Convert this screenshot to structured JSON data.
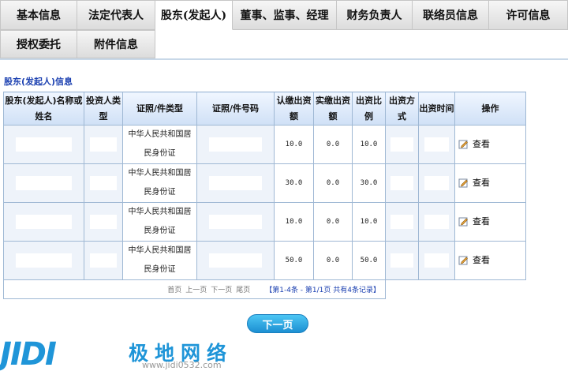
{
  "tabs_row1": [
    {
      "label": "基本信息",
      "width": 98,
      "active": false
    },
    {
      "label": "法定代表人",
      "width": 99,
      "active": false
    },
    {
      "label": "股东(发起人)",
      "width": 98,
      "active": true
    },
    {
      "label": "董事、监事、经理",
      "width": 132,
      "active": false
    },
    {
      "label": "财务负责人",
      "width": 96,
      "active": false
    },
    {
      "label": "联络员信息",
      "width": 97,
      "active": false
    },
    {
      "label": "许可信息",
      "width": 100,
      "active": false
    }
  ],
  "tabs_row2": [
    {
      "label": "授权委托",
      "width": 98,
      "active": false
    },
    {
      "label": "附件信息",
      "width": 99,
      "active": false
    }
  ],
  "section_title": "股东(发起人)信息",
  "table": {
    "headers": {
      "name": "股东(发起人)名称或姓名",
      "investor_type": "投资人类型",
      "cert_type": "证照/件类型",
      "cert_no": "证照/件号码",
      "subscribed": "认缴出资额",
      "paid": "实缴出资额",
      "ratio": "出资比例",
      "method": "出资方式",
      "date": "出资时间",
      "op": "操作"
    },
    "rows": [
      {
        "cert_type_line1": "中华人民共和国居",
        "cert_type_line2": "民身份证",
        "subscribed": "10.0",
        "paid": "0.0",
        "ratio": "10.0",
        "action": "查看"
      },
      {
        "cert_type_line1": "中华人民共和国居",
        "cert_type_line2": "民身份证",
        "subscribed": "30.0",
        "paid": "0.0",
        "ratio": "30.0",
        "action": "查看"
      },
      {
        "cert_type_line1": "中华人民共和国居",
        "cert_type_line2": "民身份证",
        "subscribed": "10.0",
        "paid": "0.0",
        "ratio": "10.0",
        "action": "查看"
      },
      {
        "cert_type_line1": "中华人民共和国居",
        "cert_type_line2": "民身份证",
        "subscribed": "50.0",
        "paid": "0.0",
        "ratio": "50.0",
        "action": "查看"
      }
    ],
    "pager": {
      "first": "首页",
      "prev": "上一页",
      "next": "下一页",
      "last": "尾页",
      "summary": "【第1-4条 - 第1/1页 共有4条记录】"
    }
  },
  "next_button": "下一页",
  "watermark": {
    "logo": "JIDI",
    "brand": "极地网络",
    "url": "www.jidi0532.com"
  },
  "colors": {
    "accent": "#1a3fb0",
    "header_bg": "#cfe0f6",
    "border": "#9fb8d4",
    "button": "#1c8fd2",
    "watermark": "#1f95d8"
  }
}
